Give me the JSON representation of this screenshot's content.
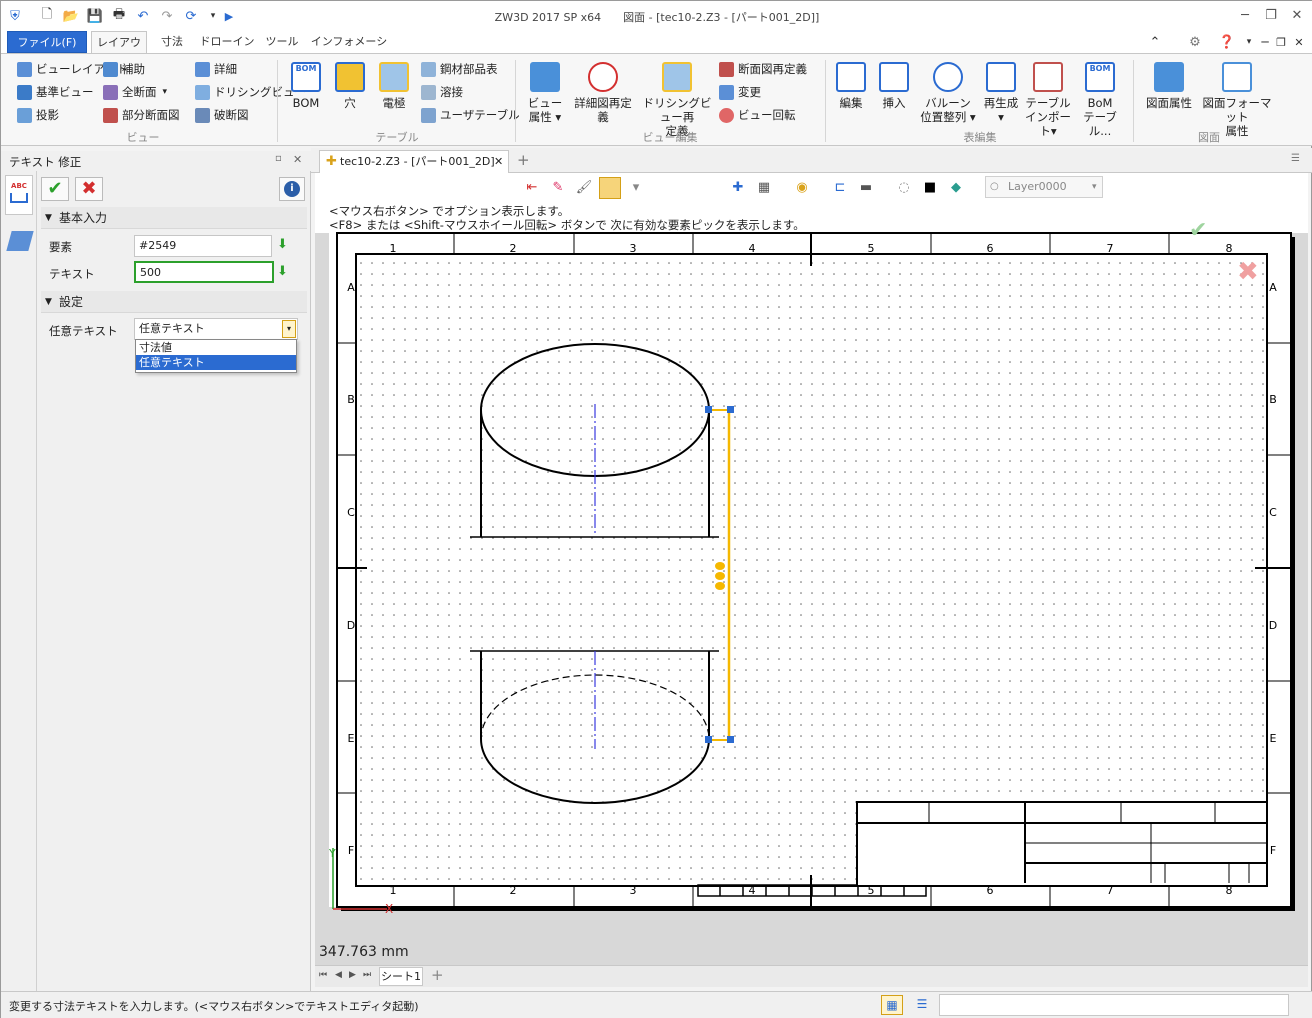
{
  "app": {
    "title": "ZW3D 2017 SP x64　　図面 - [tec10-2.Z3 - [パート001_2D]]"
  },
  "ribbon": {
    "tabs": [
      "ファイル(F)",
      "レイアウト",
      "寸法",
      "ドローイング",
      "ツール",
      "インフォメーション"
    ],
    "view_group": {
      "label": "ビュー",
      "items": [
        "ビューレイアウト",
        "基準ビュー",
        "投影",
        "補助",
        "全断面",
        "部分断面図",
        "詳細",
        "ドリシングビュー",
        "破断図"
      ]
    },
    "table_group": {
      "label": "テーブル",
      "large": [
        "BOM",
        "穴",
        "電極"
      ],
      "items": [
        "鋼材部品表",
        "溶接",
        "ユーザテーブル"
      ]
    },
    "view_edit_group": {
      "label": "ビュー編集",
      "large": [
        [
          "ビュー",
          "属性 ▾"
        ],
        [
          "詳細図再定",
          "義"
        ],
        [
          "ドリシングビュー再",
          "定義"
        ]
      ],
      "items": [
        "断面図再定義",
        "変更",
        "ビュー回転"
      ]
    },
    "table_edit_group": {
      "label": "表編集",
      "large": [
        [
          "編集",
          ""
        ],
        [
          "挿入",
          ""
        ],
        [
          "バルーン",
          "位置整列 ▾"
        ],
        [
          "再生成",
          "▾"
        ],
        [
          "テーブル",
          "インポート▾"
        ],
        [
          "BoM",
          "テーブル..."
        ]
      ]
    },
    "drawing_group": {
      "label": "図面",
      "large": [
        [
          "図面属性",
          ""
        ],
        [
          "図面フォーマット",
          "属性"
        ]
      ]
    },
    "bom_badge": "BOM"
  },
  "panel": {
    "title": "テキスト 修正",
    "basic_section": "基本入力",
    "element_label": "要素",
    "element_value": "#2549",
    "text_label": "テキスト",
    "text_value": "500",
    "settings_section": "設定",
    "arbitrary_label": "任意テキスト",
    "dropdown_value": "任意テキスト",
    "dropdown_options": [
      "寸法値",
      "任意テキスト"
    ]
  },
  "document": {
    "tab_label": "tec10-2.Z3 - [パート001_2D]",
    "hint1": "<マウス右ボタン> でオプション表示します。",
    "hint2": "<F8> または <Shift-マウスホイール回転> ボタンで 次に有効な要素ピックを表示します。",
    "layer": "Layer0000",
    "measurement": "347.763 mm",
    "col_labels": [
      "1",
      "2",
      "3",
      "4",
      "5",
      "6",
      "7",
      "8"
    ],
    "row_labels": [
      "A",
      "B",
      "C",
      "D",
      "E",
      "F"
    ],
    "sheet_tab": "シート1",
    "axis_x": "X",
    "axis_y": "Y"
  },
  "status": {
    "message": "変更する寸法テキストを入力します。(<マウス右ボタン>でテキストエディタ起動)"
  },
  "colors": {
    "accent": "#2b6bd1",
    "selection": "#f5b800",
    "centerline": "#3a3ae0",
    "confirm": "#2ca02c",
    "cancel": "#d32f2f"
  }
}
